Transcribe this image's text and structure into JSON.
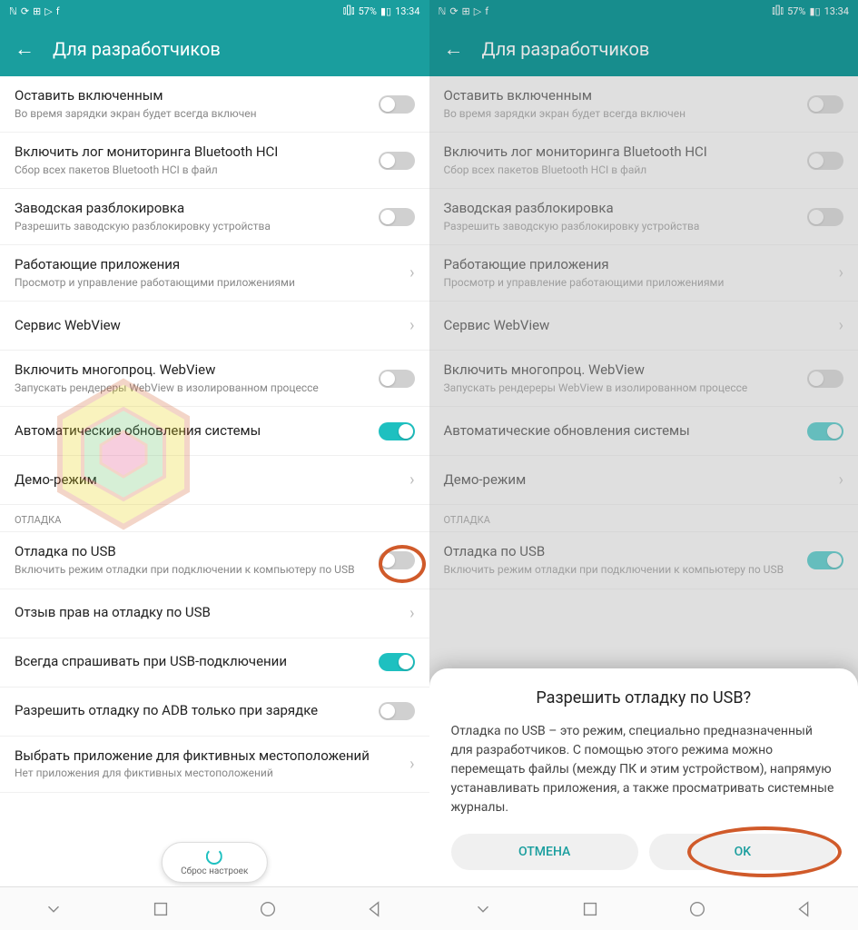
{
  "status": {
    "battery": "57%",
    "vibrate": "⫾[]⫾",
    "time": "13:34"
  },
  "header": {
    "title": "Для разработчиков"
  },
  "settings": [
    {
      "title": "Оставить включенным",
      "sub": "Во время зарядки экран будет всегда включен",
      "type": "toggle",
      "on": false
    },
    {
      "title": "Включить лог мониторинга Bluetooth HCI",
      "sub": "Сбор всех пакетов Bluetooth HCI в файл",
      "type": "toggle",
      "on": false
    },
    {
      "title": "Заводская разблокировка",
      "sub": "Разрешить заводскую разблокировку устройства",
      "type": "toggle",
      "on": false
    },
    {
      "title": "Работающие приложения",
      "sub": "Просмотр и управление работающими приложениями",
      "type": "nav"
    },
    {
      "title": "Сервис WebView",
      "sub": "",
      "type": "nav"
    },
    {
      "title": "Включить многопроц. WebView",
      "sub": "Запускать рендереры WebView в изолированном процессе",
      "type": "toggle",
      "on": false
    },
    {
      "title": "Автоматические обновления системы",
      "sub": "",
      "type": "toggle",
      "on": true
    },
    {
      "title": "Демо-режим",
      "sub": "",
      "type": "nav"
    }
  ],
  "section": "ОТЛАДКА",
  "debug": [
    {
      "title": "Отладка по USB",
      "sub": "Включить режим отладки при подключении к компьютеру по USB",
      "type": "toggle",
      "on": false
    },
    {
      "title": "Отзыв прав на отладку по USB",
      "sub": "",
      "type": "nav"
    },
    {
      "title": "Всегда спрашивать при USB-подключении",
      "sub": "",
      "type": "toggle",
      "on": true
    },
    {
      "title": "Разрешить отладку по ADB только при зарядке",
      "sub": "",
      "type": "toggle",
      "on": false
    },
    {
      "title": "Выбрать приложение для фиктивных местоположений",
      "sub": "Нет приложения для фиктивных местоположений",
      "type": "nav"
    }
  ],
  "debug_right_usb_on": true,
  "reset_label": "Сброс настроек",
  "dialog": {
    "title": "Разрешить отладку по USB?",
    "body": "Отладка по USB – это режим, специально предназначенный для разработчиков. С помощью этого режима можно перемещать файлы (между ПК и этим устройством), напрямую устанавливать приложения, а также просматривать системные журналы.",
    "cancel": "ОТМЕНА",
    "ok": "OK"
  }
}
